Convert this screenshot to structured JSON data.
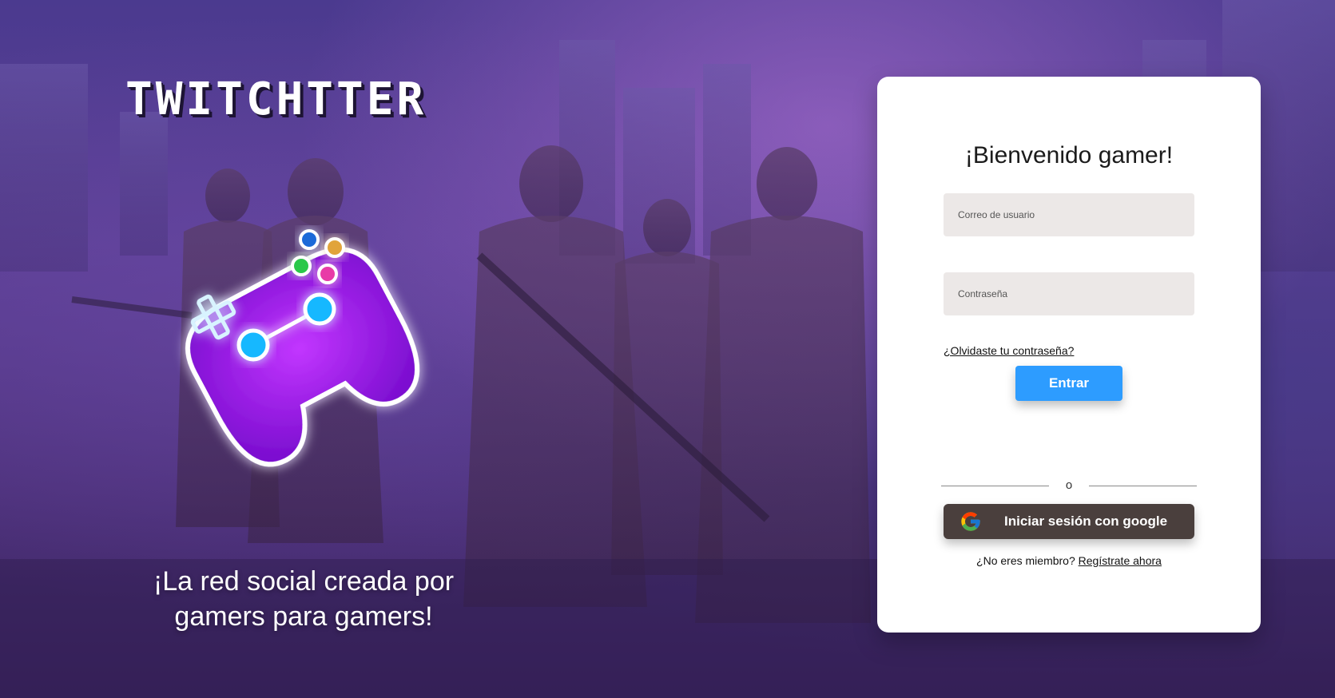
{
  "brand": {
    "name": "TWITCHTTER",
    "tagline": "¡La red social creada por gamers para gamers!"
  },
  "login": {
    "title": "¡Bienvenido gamer!",
    "email_placeholder": "Correo de usuario",
    "password_placeholder": "Contraseña",
    "forgot_link": "¿Olvidaste tu contraseña?",
    "submit_label": "Entrar",
    "divider_text": "o",
    "google_label": "Iniciar sesión con google",
    "register_prompt": "¿No eres miembro?",
    "register_link": "Regístrate ahora"
  },
  "icons": {
    "controller": "gamepad-neon-icon",
    "google": "google-icon"
  },
  "colors": {
    "primary_button": "#2d9cff",
    "google_button": "#4a3f3d",
    "input_background": "#ece8e7"
  }
}
